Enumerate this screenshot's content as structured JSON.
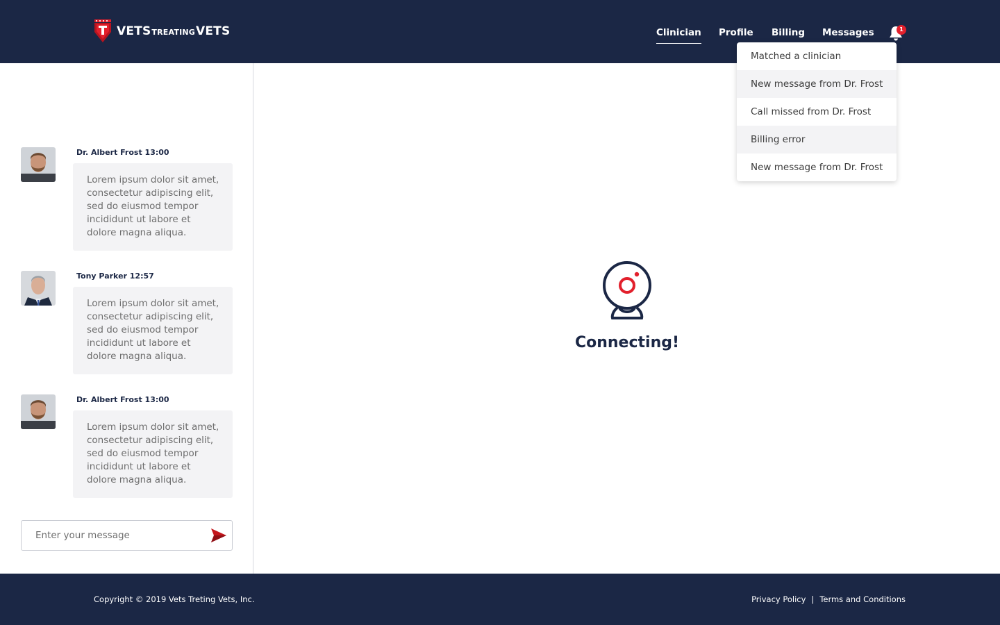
{
  "brand": {
    "logo_part1": "VETS",
    "logo_part2": "TREATING",
    "logo_part3": "VETS",
    "primary_color": "#1b2745",
    "accent_color": "#e2202c"
  },
  "nav": {
    "items": [
      {
        "label": "Clinician",
        "active": true
      },
      {
        "label": "Profile"
      },
      {
        "label": "Billing"
      },
      {
        "label": "Messages"
      }
    ],
    "notification_count": "1"
  },
  "notifications": [
    "Matched a clinician",
    "New message from Dr. Frost",
    "Call missed from Dr. Frost",
    "Billing error",
    "New message from Dr. Frost"
  ],
  "chat": {
    "messages": [
      {
        "meta": "Dr. Albert Frost 13:00",
        "text": "Lorem ipsum dolor sit amet, consectetur adipiscing elit, sed do eiusmod tempor incididunt ut labore et dolore magna aliqua.",
        "avatar_icon": "doctor-avatar"
      },
      {
        "meta": "Tony Parker 12:57",
        "text": "Lorem ipsum dolor sit amet, consectetur adipiscing elit, sed do eiusmod tempor incididunt ut labore et dolore magna aliqua.",
        "avatar_icon": "patient-avatar"
      },
      {
        "meta": "Dr. Albert Frost 13:00",
        "text": "Lorem ipsum dolor sit amet, consectetur adipiscing elit, sed do eiusmod tempor incididunt ut labore et dolore magna aliqua.",
        "avatar_icon": "doctor-avatar"
      }
    ],
    "input_placeholder": "Enter your message"
  },
  "main": {
    "status": "Connecting!",
    "icon": "webcam-icon"
  },
  "footer": {
    "copyright": "Copyright © 2019 Vets Treting Vets, Inc.",
    "privacy": "Privacy Policy",
    "separator": "|",
    "terms": "Terms and Conditions"
  }
}
